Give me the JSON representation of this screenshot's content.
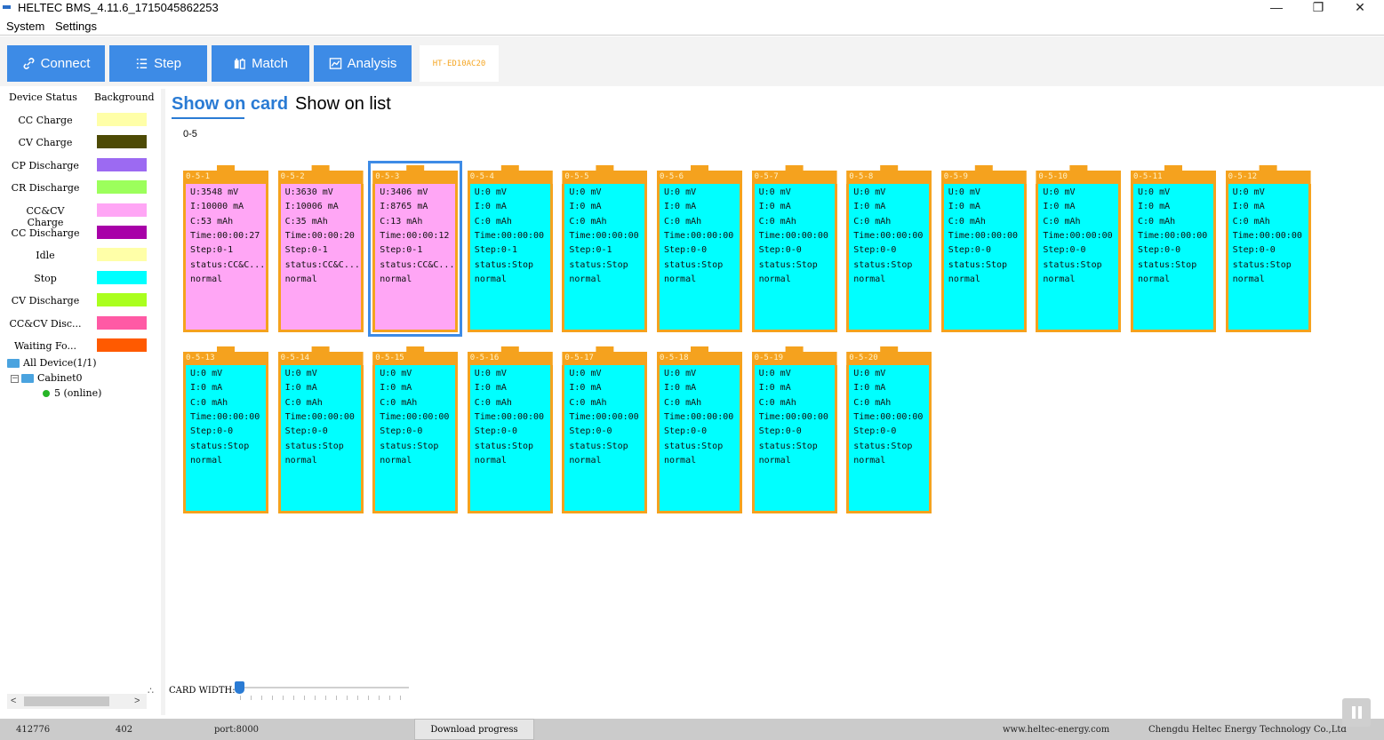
{
  "window": {
    "title": "HELTEC BMS_4.11.6_1715045862253",
    "minimize": "—",
    "restore": "❐",
    "close": "✕"
  },
  "menu": {
    "system": "System",
    "settings": "Settings"
  },
  "toolbar": {
    "connect": "Connect",
    "step": "Step",
    "match": "Match",
    "analysis": "Analysis",
    "device_tab": "HT-ED10AC20",
    "button_color": "#3d8be6"
  },
  "legend": {
    "header_status": "Device Status",
    "header_background": "Background",
    "items": [
      {
        "label": "CC Charge",
        "color": "#ffffa8"
      },
      {
        "label": "CV Charge",
        "color": "#4d4a05"
      },
      {
        "label": "CP Discharge",
        "color": "#9c6af2"
      },
      {
        "label": "CR Discharge",
        "color": "#9cff5c"
      },
      {
        "label": "CC&CV Charge",
        "color": "#ffa6f5"
      },
      {
        "label": "CC Discharge",
        "color": "#a800a8"
      },
      {
        "label": "Idle",
        "color": "#ffffa8"
      },
      {
        "label": "Stop",
        "color": "#00ffff"
      },
      {
        "label": "CV Discharge",
        "color": "#aaff1e"
      },
      {
        "label": "CC&CV Disc...",
        "color": "#ff5aa5"
      },
      {
        "label": "Waiting Fo...",
        "color": "#ff5a00"
      }
    ]
  },
  "tree": {
    "root": "All Device(1/1)",
    "cabinet": "Cabinet0",
    "device": "5 (online)"
  },
  "view_tabs": {
    "card": "Show on card",
    "list": "Show on list"
  },
  "group_label": "0-5",
  "cards": [
    {
      "name": "0-5-1",
      "u": "U:3548 mV",
      "i": "I:10000 mA",
      "c": "C:53 mAh",
      "time": "Time:00:00:27",
      "step": "Step:0-1",
      "status": "status:CC&C...",
      "state": "normal",
      "color": "#ffa6f5"
    },
    {
      "name": "0-5-2",
      "u": "U:3630 mV",
      "i": "I:10006 mA",
      "c": "C:35 mAh",
      "time": "Time:00:00:20",
      "step": "Step:0-1",
      "status": "status:CC&C...",
      "state": "normal",
      "color": "#ffa6f5"
    },
    {
      "name": "0-5-3",
      "u": "U:3406 mV",
      "i": "I:8765 mA",
      "c": "C:13 mAh",
      "time": "Time:00:00:12",
      "step": "Step:0-1",
      "status": "status:CC&C...",
      "state": "normal",
      "color": "#ffa6f5"
    },
    {
      "name": "0-5-4",
      "u": "U:0 mV",
      "i": "I:0 mA",
      "c": "C:0 mAh",
      "time": "Time:00:00:00",
      "step": "Step:0-1",
      "status": "status:Stop",
      "state": "normal",
      "color": "#00ffff"
    },
    {
      "name": "0-5-5",
      "u": "U:0 mV",
      "i": "I:0 mA",
      "c": "C:0 mAh",
      "time": "Time:00:00:00",
      "step": "Step:0-1",
      "status": "status:Stop",
      "state": "normal",
      "color": "#00ffff"
    },
    {
      "name": "0-5-6",
      "u": "U:0 mV",
      "i": "I:0 mA",
      "c": "C:0 mAh",
      "time": "Time:00:00:00",
      "step": "Step:0-0",
      "status": "status:Stop",
      "state": "normal",
      "color": "#00ffff"
    },
    {
      "name": "0-5-7",
      "u": "U:0 mV",
      "i": "I:0 mA",
      "c": "C:0 mAh",
      "time": "Time:00:00:00",
      "step": "Step:0-0",
      "status": "status:Stop",
      "state": "normal",
      "color": "#00ffff"
    },
    {
      "name": "0-5-8",
      "u": "U:0 mV",
      "i": "I:0 mA",
      "c": "C:0 mAh",
      "time": "Time:00:00:00",
      "step": "Step:0-0",
      "status": "status:Stop",
      "state": "normal",
      "color": "#00ffff"
    },
    {
      "name": "0-5-9",
      "u": "U:0 mV",
      "i": "I:0 mA",
      "c": "C:0 mAh",
      "time": "Time:00:00:00",
      "step": "Step:0-0",
      "status": "status:Stop",
      "state": "normal",
      "color": "#00ffff"
    },
    {
      "name": "0-5-10",
      "u": "U:0 mV",
      "i": "I:0 mA",
      "c": "C:0 mAh",
      "time": "Time:00:00:00",
      "step": "Step:0-0",
      "status": "status:Stop",
      "state": "normal",
      "color": "#00ffff"
    },
    {
      "name": "0-5-11",
      "u": "U:0 mV",
      "i": "I:0 mA",
      "c": "C:0 mAh",
      "time": "Time:00:00:00",
      "step": "Step:0-0",
      "status": "status:Stop",
      "state": "normal",
      "color": "#00ffff"
    },
    {
      "name": "0-5-12",
      "u": "U:0 mV",
      "i": "I:0 mA",
      "c": "C:0 mAh",
      "time": "Time:00:00:00",
      "step": "Step:0-0",
      "status": "status:Stop",
      "state": "normal",
      "color": "#00ffff"
    },
    {
      "name": "0-5-13",
      "u": "U:0 mV",
      "i": "I:0 mA",
      "c": "C:0 mAh",
      "time": "Time:00:00:00",
      "step": "Step:0-0",
      "status": "status:Stop",
      "state": "normal",
      "color": "#00ffff"
    },
    {
      "name": "0-5-14",
      "u": "U:0 mV",
      "i": "I:0 mA",
      "c": "C:0 mAh",
      "time": "Time:00:00:00",
      "step": "Step:0-0",
      "status": "status:Stop",
      "state": "normal",
      "color": "#00ffff"
    },
    {
      "name": "0-5-15",
      "u": "U:0 mV",
      "i": "I:0 mA",
      "c": "C:0 mAh",
      "time": "Time:00:00:00",
      "step": "Step:0-0",
      "status": "status:Stop",
      "state": "normal",
      "color": "#00ffff"
    },
    {
      "name": "0-5-16",
      "u": "U:0 mV",
      "i": "I:0 mA",
      "c": "C:0 mAh",
      "time": "Time:00:00:00",
      "step": "Step:0-0",
      "status": "status:Stop",
      "state": "normal",
      "color": "#00ffff"
    },
    {
      "name": "0-5-17",
      "u": "U:0 mV",
      "i": "I:0 mA",
      "c": "C:0 mAh",
      "time": "Time:00:00:00",
      "step": "Step:0-0",
      "status": "status:Stop",
      "state": "normal",
      "color": "#00ffff"
    },
    {
      "name": "0-5-18",
      "u": "U:0 mV",
      "i": "I:0 mA",
      "c": "C:0 mAh",
      "time": "Time:00:00:00",
      "step": "Step:0-0",
      "status": "status:Stop",
      "state": "normal",
      "color": "#00ffff"
    },
    {
      "name": "0-5-19",
      "u": "U:0 mV",
      "i": "I:0 mA",
      "c": "C:0 mAh",
      "time": "Time:00:00:00",
      "step": "Step:0-0",
      "status": "status:Stop",
      "state": "normal",
      "color": "#00ffff"
    },
    {
      "name": "0-5-20",
      "u": "U:0 mV",
      "i": "I:0 mA",
      "c": "C:0 mAh",
      "time": "Time:00:00:00",
      "step": "Step:0-0",
      "status": "status:Stop",
      "state": "normal",
      "color": "#00ffff"
    }
  ],
  "selected_card": "0-5-3",
  "card_width": {
    "label": "CARD WIDTH:",
    "value_fraction": 0.0
  },
  "statusbar": {
    "counter": "412776",
    "code": "402",
    "port": "port:8000",
    "download": "Download progress",
    "website": "www.heltec-energy.com",
    "company": "Chengdu Heltec Energy Technology Co.,Ltd"
  },
  "colors": {
    "accent": "#2a7bd4",
    "card_border": "#f5a21e",
    "stop": "#00ffff",
    "ccv_charge": "#ffa6f5"
  }
}
